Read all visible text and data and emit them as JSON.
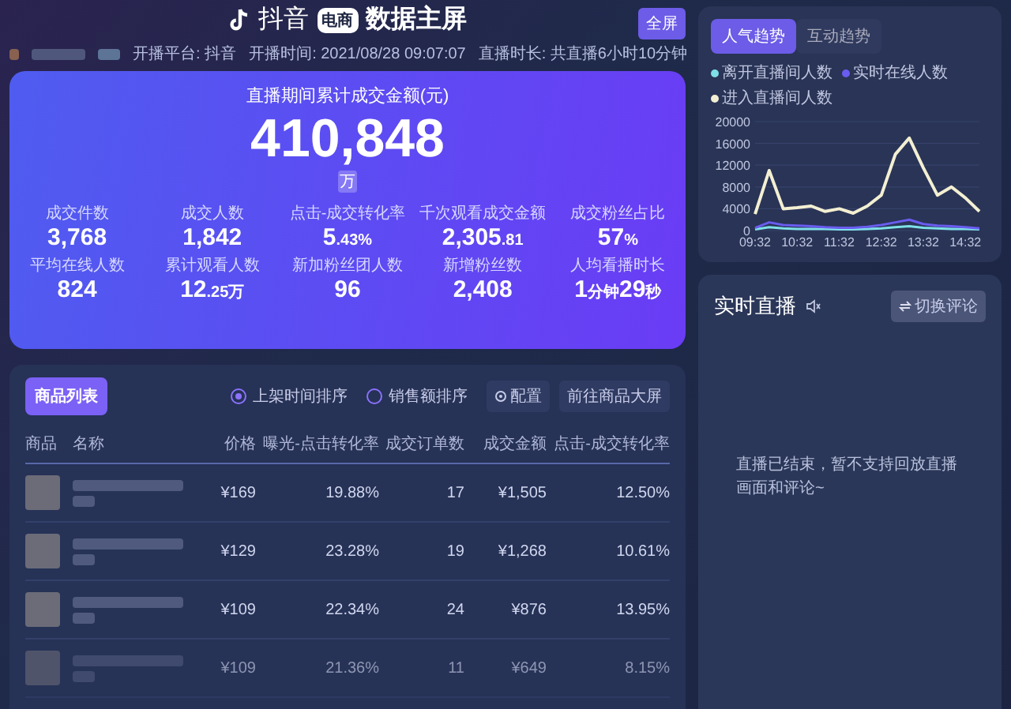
{
  "header": {
    "brand": "抖音",
    "brand_tag": "电商",
    "title": "数据主屏",
    "fullscreen_button": "全屏",
    "platform": "开播平台: 抖音",
    "start_time": "开播时间: 2021/08/28 09:07:07",
    "duration": "直播时长: 共直播6小时10分钟"
  },
  "summary": {
    "title": "直播期间累计成交金额(元)",
    "total": "410,848",
    "unit": "万",
    "metrics": [
      {
        "label": "成交件数",
        "parts": [
          {
            "text": "3,768",
            "small": false
          }
        ]
      },
      {
        "label": "成交人数",
        "parts": [
          {
            "text": "1,842",
            "small": false
          }
        ]
      },
      {
        "label": "点击-成交转化率",
        "parts": [
          {
            "text": "5",
            "small": false
          },
          {
            "text": ".43%",
            "small": true
          }
        ]
      },
      {
        "label": "千次观看成交金额",
        "parts": [
          {
            "text": "2,305",
            "small": false
          },
          {
            "text": ".81",
            "small": true
          }
        ]
      },
      {
        "label": "成交粉丝占比",
        "parts": [
          {
            "text": "57",
            "small": false
          },
          {
            "text": "%",
            "small": true
          }
        ]
      },
      {
        "label": "平均在线人数",
        "parts": [
          {
            "text": "824",
            "small": false
          }
        ]
      },
      {
        "label": "累计观看人数",
        "parts": [
          {
            "text": "12",
            "small": false
          },
          {
            "text": ".25万",
            "small": true
          }
        ]
      },
      {
        "label": "新加粉丝团人数",
        "parts": [
          {
            "text": "96",
            "small": false
          }
        ]
      },
      {
        "label": "新增粉丝数",
        "parts": [
          {
            "text": "2,408",
            "small": false
          }
        ]
      },
      {
        "label": "人均看播时长",
        "parts": [
          {
            "text": "1",
            "small": false
          },
          {
            "text": "分钟",
            "small": true
          },
          {
            "text": "29",
            "small": false
          },
          {
            "text": "秒",
            "small": true
          }
        ]
      }
    ]
  },
  "products": {
    "tab": "商品列表",
    "sort_options": [
      {
        "label": "上架时间排序",
        "selected": true
      },
      {
        "label": "销售额排序",
        "selected": false
      }
    ],
    "buttons": [
      "配置",
      "前往商品大屏"
    ],
    "columns": [
      "商品",
      "名称",
      "价格",
      "曝光-点击转化率",
      "成交订单数",
      "成交金额",
      "点击-成交转化率"
    ],
    "rows": [
      {
        "price": "¥169",
        "exposure_rate": "19.88%",
        "orders": "17",
        "amount": "¥1,505",
        "click_rate": "12.50%"
      },
      {
        "price": "¥129",
        "exposure_rate": "23.28%",
        "orders": "19",
        "amount": "¥1,268",
        "click_rate": "10.61%"
      },
      {
        "price": "¥109",
        "exposure_rate": "22.34%",
        "orders": "24",
        "amount": "¥876",
        "click_rate": "13.95%"
      },
      {
        "price": "¥109",
        "exposure_rate": "21.36%",
        "orders": "11",
        "amount": "¥649",
        "click_rate": "8.15%"
      }
    ]
  },
  "trend": {
    "tabs": [
      {
        "label": "人气趋势",
        "selected": true
      },
      {
        "label": "互动趋势",
        "selected": false
      }
    ],
    "chart_data": {
      "type": "line",
      "grid": true,
      "x": [
        572,
        592,
        612,
        632,
        652,
        672,
        692,
        712,
        732,
        752,
        772,
        792,
        812,
        832,
        852,
        872,
        892
      ],
      "xlim": [
        572,
        892
      ],
      "xticks": [
        {
          "value": 572,
          "label": "09:32"
        },
        {
          "value": 632,
          "label": "10:32"
        },
        {
          "value": 692,
          "label": "11:32"
        },
        {
          "value": 752,
          "label": "12:32"
        },
        {
          "value": 812,
          "label": "13:32"
        },
        {
          "value": 872,
          "label": "14:32"
        }
      ],
      "yticks": [
        0,
        4000,
        8000,
        12000,
        16000,
        20000
      ],
      "ylim": [
        0,
        20000
      ],
      "series": [
        {
          "name": "离开直播间人数",
          "color": "#7ee0e8",
          "values": [
            200,
            600,
            400,
            300,
            300,
            300,
            200,
            200,
            300,
            400,
            600,
            800,
            500,
            400,
            300,
            300,
            200
          ]
        },
        {
          "name": "实时在线人数",
          "color": "#6a5cf0",
          "values": [
            500,
            1500,
            1000,
            900,
            800,
            600,
            500,
            500,
            700,
            1000,
            1500,
            2000,
            1200,
            900,
            800,
            600,
            400
          ]
        },
        {
          "name": "进入直播间人数",
          "color": "#f3efd2",
          "values": [
            3000,
            11000,
            4000,
            4200,
            4500,
            3500,
            4000,
            3200,
            4500,
            6500,
            14000,
            17000,
            11500,
            6500,
            8000,
            6000,
            3500
          ]
        }
      ]
    }
  },
  "live": {
    "title": "实时直播",
    "switch_button": "切换评论",
    "message": "直播已结束，暂不支持回放直播画面和评论~"
  }
}
